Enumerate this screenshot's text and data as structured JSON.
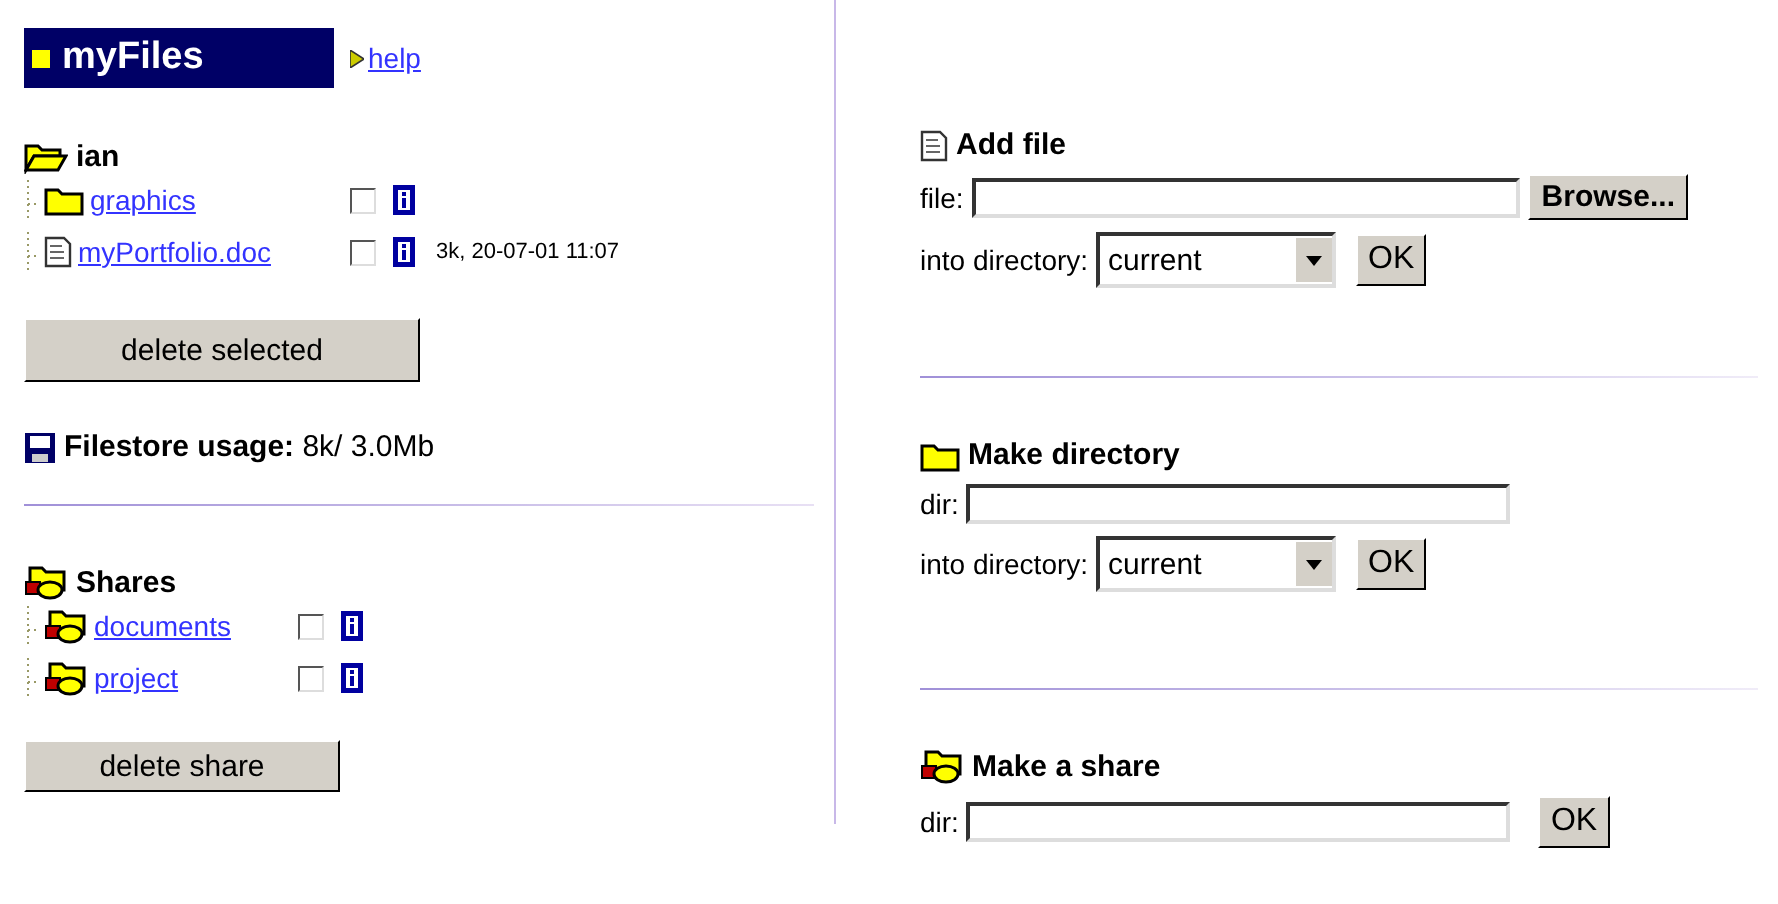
{
  "header": {
    "title": "myFiles",
    "help_link": "help"
  },
  "files": {
    "owner": "ian",
    "items": [
      {
        "kind": "folder",
        "name": "graphics",
        "checked": false
      },
      {
        "kind": "document",
        "name": "myPortfolio.doc",
        "checked": false,
        "details": "3k, 20-07-01 11:07"
      }
    ]
  },
  "delete_selected_button": "delete selected",
  "usage": {
    "label": "Filestore usage:",
    "value": "8k/ 3.0Mb"
  },
  "shares": {
    "title": "Shares",
    "items": [
      {
        "kind": "share",
        "name": "documents",
        "checked": false
      },
      {
        "kind": "share",
        "name": "project",
        "checked": false
      }
    ]
  },
  "delete_share_button": "delete share",
  "forms": [
    {
      "kind": "document",
      "title": "Add file",
      "fields": [
        {
          "kind": "file",
          "label": "file:",
          "button": "Browse..."
        },
        {
          "kind": "select",
          "label": "into directory:",
          "value": "current",
          "button": "OK"
        }
      ]
    },
    {
      "kind": "folder",
      "title": "Make directory",
      "fields": [
        {
          "kind": "text",
          "label": "dir:"
        },
        {
          "kind": "select",
          "label": "into directory:",
          "value": "current",
          "button": "OK"
        }
      ]
    },
    {
      "kind": "share",
      "title": "Make a share",
      "fields": [
        {
          "kind": "text",
          "label": "dir:",
          "button": "OK"
        }
      ]
    }
  ]
}
